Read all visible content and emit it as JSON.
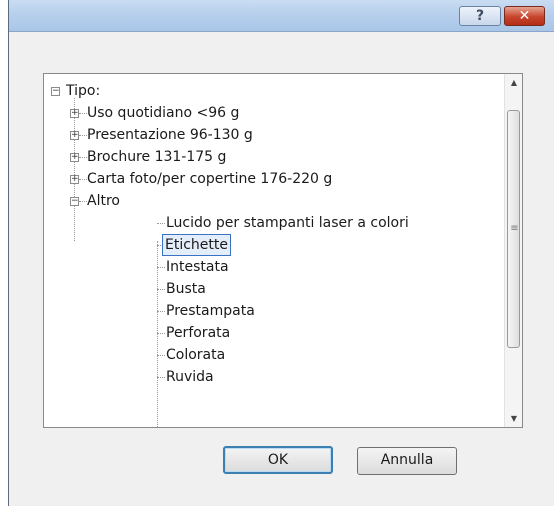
{
  "titlebar": {
    "help_label": "?",
    "close_label": "✕"
  },
  "tree": {
    "root": {
      "label": "Tipo:",
      "expander": "−"
    },
    "categories": [
      {
        "label": "Uso quotidiano <96 g",
        "expander": "+"
      },
      {
        "label": "Presentazione 96-130 g",
        "expander": "+"
      },
      {
        "label": "Brochure 131-175 g",
        "expander": "+"
      },
      {
        "label": "Carta foto/per copertine 176-220 g",
        "expander": "+"
      },
      {
        "label": "Altro",
        "expander": "−"
      }
    ],
    "altro_items": [
      "Lucido per stampanti laser a colori",
      "Etichette",
      "Intestata",
      "Busta",
      "Prestampata",
      "Perforata",
      "Colorata",
      "Ruvida"
    ],
    "selected_item": "Etichette"
  },
  "buttons": {
    "ok_label": "OK",
    "cancel_label": "Annulla"
  },
  "colors": {
    "selection_border": "#3a73c6",
    "titlebar": "#b6cfec",
    "close_button": "#c8452c"
  }
}
